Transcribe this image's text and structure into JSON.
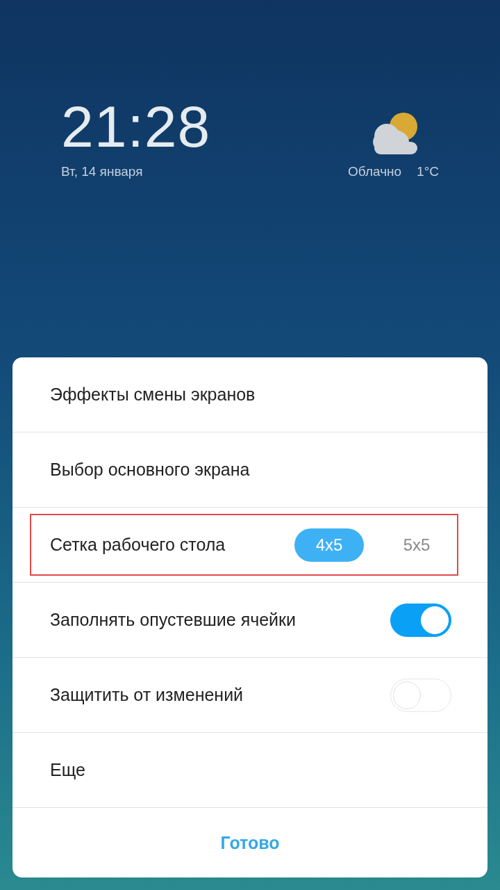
{
  "lock_screen": {
    "time": "21:28",
    "date": "Вт, 14 января",
    "weather": {
      "condition": "Облачно",
      "temperature": "1°C"
    }
  },
  "sheet": {
    "items": [
      {
        "kind": "plain",
        "label": "Эффекты смены экранов",
        "highlighted": false
      },
      {
        "kind": "plain",
        "label": "Выбор основного экрана",
        "highlighted": false
      },
      {
        "kind": "segmented",
        "label": "Сетка рабочего стола",
        "highlighted": true,
        "options": [
          {
            "label": "4x5",
            "selected": true
          },
          {
            "label": "5x5",
            "selected": false
          }
        ]
      },
      {
        "kind": "toggle",
        "label": "Заполнять опустевшие ячейки",
        "highlighted": false,
        "on": true
      },
      {
        "kind": "toggle",
        "label": "Защитить от изменений",
        "highlighted": false,
        "on": false
      },
      {
        "kind": "plain",
        "label": "Еще",
        "highlighted": false
      }
    ],
    "done_button": "Готово"
  }
}
